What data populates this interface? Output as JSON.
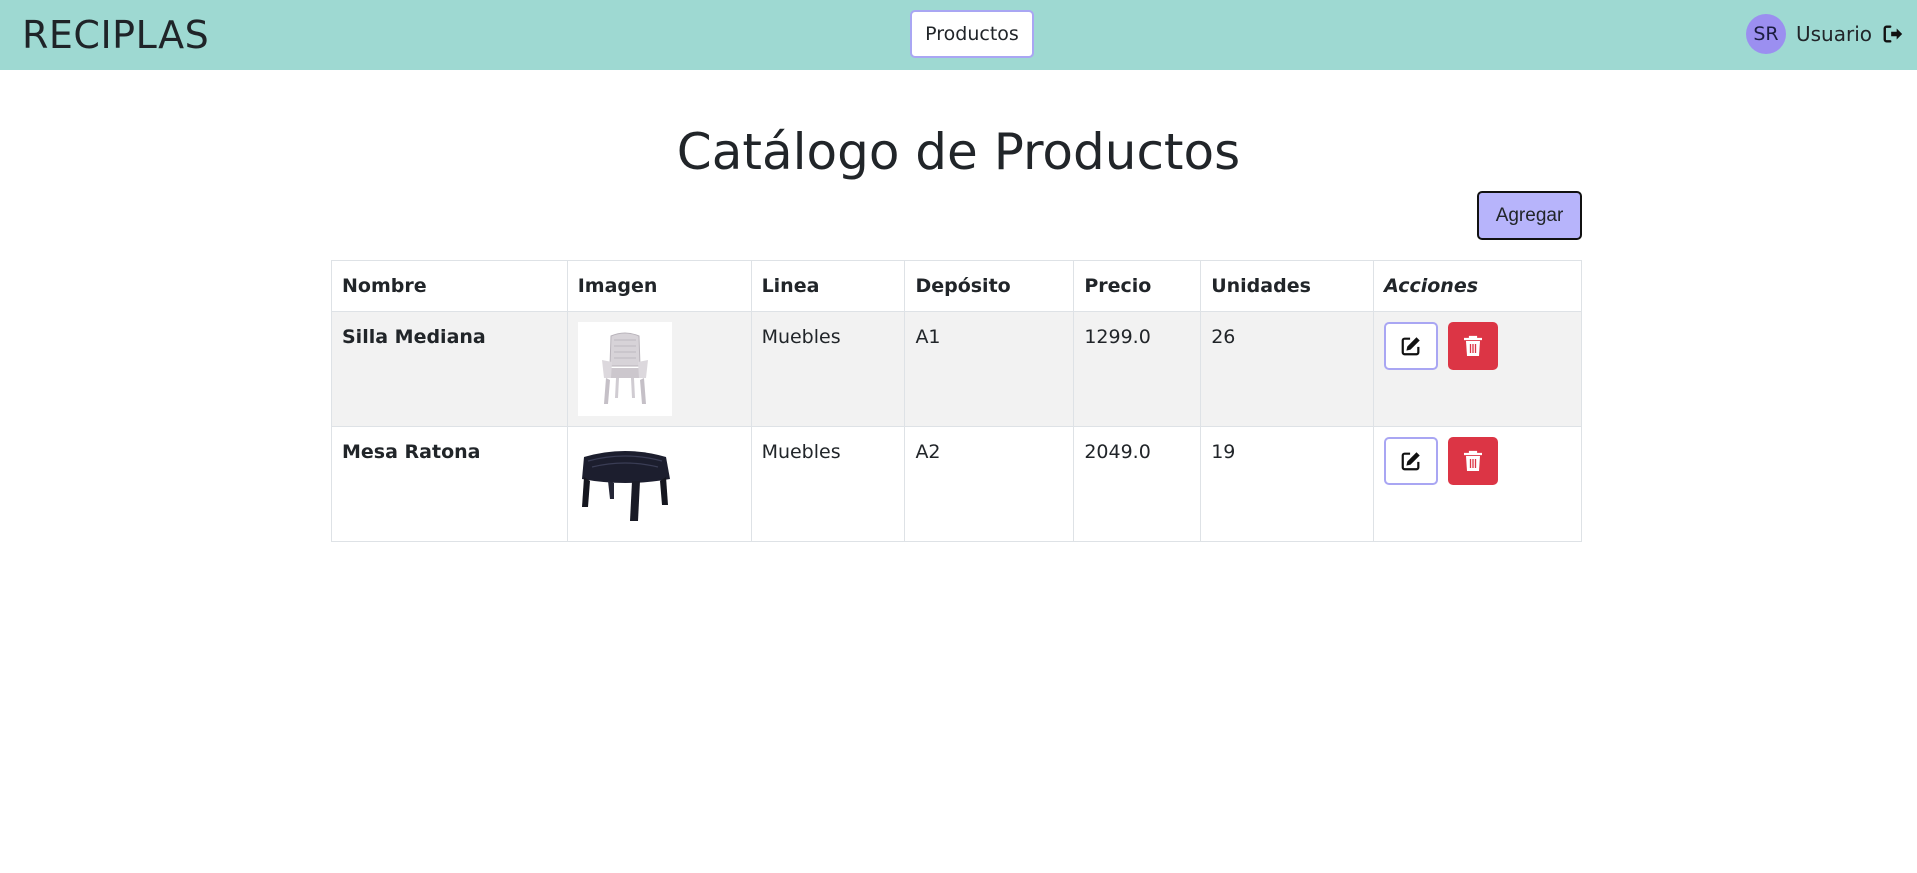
{
  "navbar": {
    "brand": "RECIPLAS",
    "nav_button": "Productos",
    "avatar_initials": "SR",
    "user_name": "Usuario",
    "background": "#9ed9d2"
  },
  "page": {
    "title": "Catálogo de Productos",
    "add_button": "Agregar"
  },
  "table": {
    "headers": [
      "Nombre",
      "Imagen",
      "Linea",
      "Depósito",
      "Precio",
      "Unidades",
      "Acciones"
    ],
    "rows": [
      {
        "nombre": "Silla Mediana",
        "imagen": "plastic-chair-image",
        "linea": "Muebles",
        "deposito": "A1",
        "precio": "1299.0",
        "unidades": "26"
      },
      {
        "nombre": "Mesa Ratona",
        "imagen": "plastic-table-image",
        "linea": "Muebles",
        "deposito": "A2",
        "precio": "2049.0",
        "unidades": "19"
      }
    ]
  },
  "icons": {
    "edit": "edit-icon",
    "delete": "trash-icon",
    "logout": "logout-icon"
  },
  "colors": {
    "accent": "#b7b4fb",
    "danger": "#dc3545",
    "avatar": "#9b8ff0"
  }
}
